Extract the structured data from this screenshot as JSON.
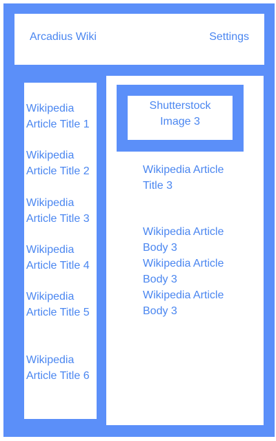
{
  "colors": {
    "frame": "#5b8ff9",
    "text": "#4a86f0",
    "panel": "#ffffff"
  },
  "header": {
    "title": "Arcadius Wiki",
    "settings_label": "Settings"
  },
  "sidebar": {
    "items": [
      {
        "label": "Wikipedia Article Title 1"
      },
      {
        "label": "Wikipedia Article Title 2"
      },
      {
        "label": "Wikipedia Article Title 3"
      },
      {
        "label": "Wikipedia Article Title 4"
      },
      {
        "label": "Wikipedia Article Title 5"
      },
      {
        "label": "Wikipedia Article Title 6"
      }
    ]
  },
  "main": {
    "image_label": "Shutterstock Image 3",
    "article_title": "Wikipedia Article Title 3",
    "article_body": "Wikipedia Article Body 3 Wikipedia Article Body 3 Wikipedia Article Body 3"
  }
}
